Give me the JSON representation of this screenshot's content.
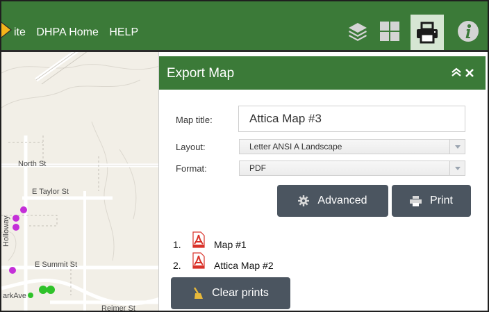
{
  "nav": {
    "links": [
      "ite",
      "DHPA Home",
      "HELP"
    ]
  },
  "toolbar": {
    "icons": [
      "layers-icon",
      "grid-icon",
      "print-icon",
      "info-icon"
    ],
    "active": "print-icon"
  },
  "map": {
    "streets": [
      "North St",
      "E Taylor St",
      "Holloway",
      "E Summit St",
      "arkAve",
      "Reimer St"
    ]
  },
  "panel": {
    "title": "Export Map",
    "map_title_label": "Map title:",
    "map_title_value": "Attica Map #3",
    "layout_label": "Layout:",
    "layout_value": "Letter ANSI A Landscape",
    "format_label": "Format:",
    "format_value": "PDF",
    "advanced_label": "Advanced",
    "print_label": "Print",
    "prints": [
      {
        "num": "1.",
        "name": "Map #1"
      },
      {
        "num": "2.",
        "name": "Attica Map #2"
      }
    ],
    "clear_label": "Clear prints"
  },
  "colors": {
    "header_green": "#3b7a38",
    "button_gray": "#4b5560",
    "marker_purple": "#c42fd8",
    "marker_green": "#2fc22a"
  }
}
